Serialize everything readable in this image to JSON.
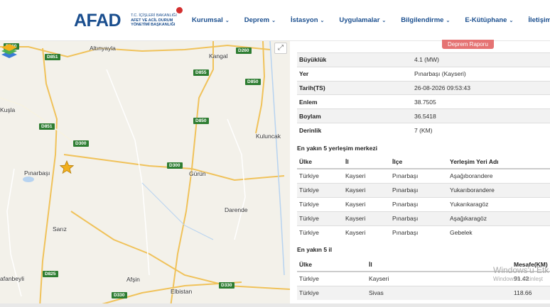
{
  "header": {
    "logo_text": "AFAD",
    "logo_sub_line1": "T.C. İÇİŞLERİ BAKANLIĞI",
    "logo_sub_line2": "AFET VE ACİL DURUM",
    "logo_sub_line3": "YÖNETİMİ BAŞKANLIĞI",
    "nav": [
      {
        "label": "Kurumsal"
      },
      {
        "label": "Deprem"
      },
      {
        "label": "İstasyon"
      },
      {
        "label": "Uygulamalar"
      },
      {
        "label": "Bilgilendirme"
      },
      {
        "label": "E-Kütüphane"
      },
      {
        "label": "İletişim"
      }
    ],
    "colors": {
      "brand": "#1a4e8e",
      "accent": "#d32f2f"
    }
  },
  "map": {
    "places": [
      "Altınyayla",
      "Kangal",
      "Kuşla",
      "Kuluncak",
      "Pınarbaşı",
      "Gürün",
      "Darende",
      "Sarız",
      "Afşin",
      "Elbistan",
      "afanbeyli"
    ],
    "roads": [
      "D260",
      "D851",
      "D260",
      "D855",
      "D850",
      "D850",
      "D851",
      "D300",
      "D300",
      "D825",
      "D330",
      "D330"
    ],
    "marker": "star-icon"
  },
  "panel": {
    "report_button": "Deprem Raporu",
    "details": [
      {
        "key": "Büyüklük",
        "value": "4.1 (MW)"
      },
      {
        "key": "Yer",
        "value": "Pınarbaşı (Kayseri)"
      },
      {
        "key": "Tarih(TS)",
        "value": "26-08-2026 09:53:43"
      },
      {
        "key": "Enlem",
        "value": "38.7505"
      },
      {
        "key": "Boylam",
        "value": "36.5418"
      },
      {
        "key": "Derinlik",
        "value": "7 (KM)"
      }
    ],
    "settlements_title": "En yakın 5 yerleşim merkezi",
    "settlements_headers": [
      "Ülke",
      "İl",
      "İlçe",
      "Yerleşim Yeri Adı"
    ],
    "settlements": [
      [
        "Türkiye",
        "Kayseri",
        "Pınarbaşı",
        "Aşağıborandere"
      ],
      [
        "Türkiye",
        "Kayseri",
        "Pınarbaşı",
        "Yukarıborandere"
      ],
      [
        "Türkiye",
        "Kayseri",
        "Pınarbaşı",
        "Yukarıkaragöz"
      ],
      [
        "Türkiye",
        "Kayseri",
        "Pınarbaşı",
        "Aşağıkaragöz"
      ],
      [
        "Türkiye",
        "Kayseri",
        "Pınarbaşı",
        "Gebelek"
      ]
    ],
    "provinces_title": "En yakın 5 il",
    "provinces_headers": [
      "Ülke",
      "İl",
      "Mesafe(KM)"
    ],
    "provinces": [
      [
        "Türkiye",
        "Kayseri",
        "91.42"
      ],
      [
        "Türkiye",
        "Sivas",
        "118.66"
      ]
    ],
    "watermark_line1": "Windows'u Etk",
    "watermark_line2": "Windows'u etkinleşt"
  }
}
